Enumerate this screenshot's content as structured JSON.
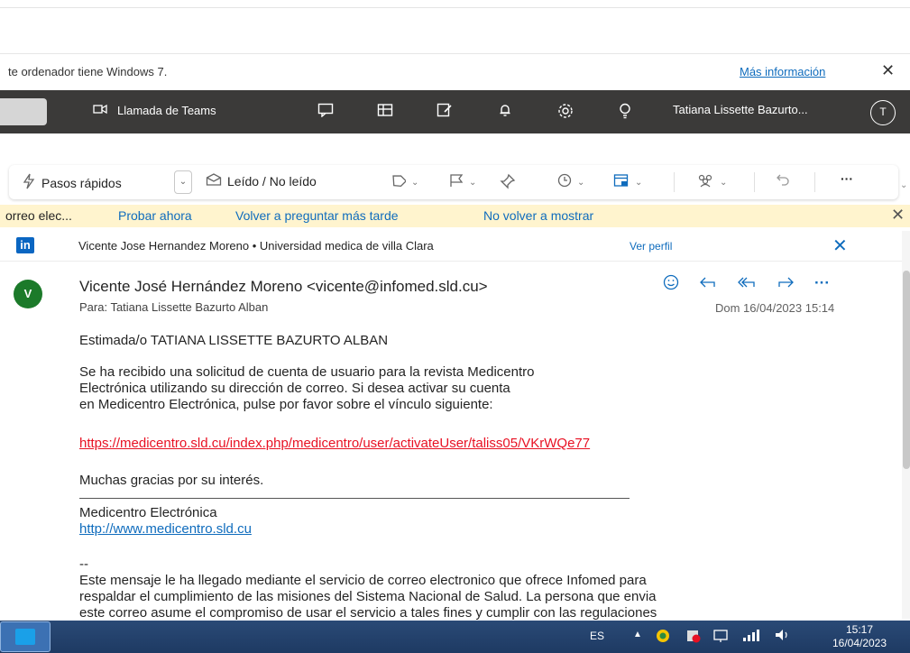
{
  "notice": {
    "text": "te ordenador tiene Windows 7.",
    "more_link": "Más información",
    "close_glyph": "✕"
  },
  "header": {
    "teams_call_label": "Llamada de Teams",
    "user_name": "Tatiana Lissette Bazurto...",
    "avatar_initial": "T",
    "icons": [
      "video-icon",
      "chat-icon",
      "office-icon",
      "note-icon",
      "bell-icon",
      "gear-icon",
      "lightbulb-icon"
    ]
  },
  "toolbar": {
    "quick_steps_label": "Pasos rápidos",
    "read_unread_label": "Leído / No leído",
    "more_glyph": "···"
  },
  "infobar": {
    "prefix": "orreo elec...",
    "try_now": "Probar ahora",
    "ask_later": "Volver a preguntar más tarde",
    "dont_show": "No volver a mostrar",
    "close_glyph": "✕"
  },
  "linkedin": {
    "logo": "in",
    "text": "Vicente Jose Hernandez Moreno • Universidad medica de villa Clara",
    "view_profile": "Ver perfil",
    "close_glyph": "✕"
  },
  "message": {
    "avatar_initial": "V",
    "from": "Vicente José Hernández Moreno <vicente@infomed.sld.cu>",
    "to": "Para:  Tatiana Lissette Bazurto Alban",
    "date": "Dom 16/04/2023 15:14",
    "greeting": "Estimada/o TATIANA LISSETTE BAZURTO ALBAN",
    "body_line1": "Se ha recibido una solicitud de cuenta de usuario para la revista Medicentro",
    "body_line2": "Electrónica utilizando su dirección de correo. Si desea activar su cuenta",
    "body_line3": "en Medicentro Electrónica, pulse por favor sobre el vínculo siguiente:",
    "activation_link": "https://medicentro.sld.cu/index.php/medicentro/user/activateUser/taliss05/VKrWQe77",
    "thanks": "Muchas gracias por su interés.",
    "signature_name": "Medicentro Electrónica",
    "signature_url": "http://www.medicentro.sld.cu",
    "sig_sep": "--",
    "footer_line1": "Este mensaje le ha llegado mediante el servicio de correo electronico que ofrece Infomed para",
    "footer_line2": "respaldar el cumplimiento de las misiones del Sistema Nacional de Salud. La persona que envia",
    "footer_line3": "este correo asume el compromiso de usar el servicio a tales fines y cumplir con las regulaciones"
  },
  "taskbar": {
    "language": "ES",
    "time": "15:17",
    "date": "16/04/2023"
  },
  "colors": {
    "header_bg": "#3b3a39",
    "accent": "#0f6cbd",
    "infobar_bg": "#fff4ce",
    "link_red": "#e81123",
    "avatar_green": "#1c7a2a",
    "linkedin_blue": "#0a66c2"
  }
}
